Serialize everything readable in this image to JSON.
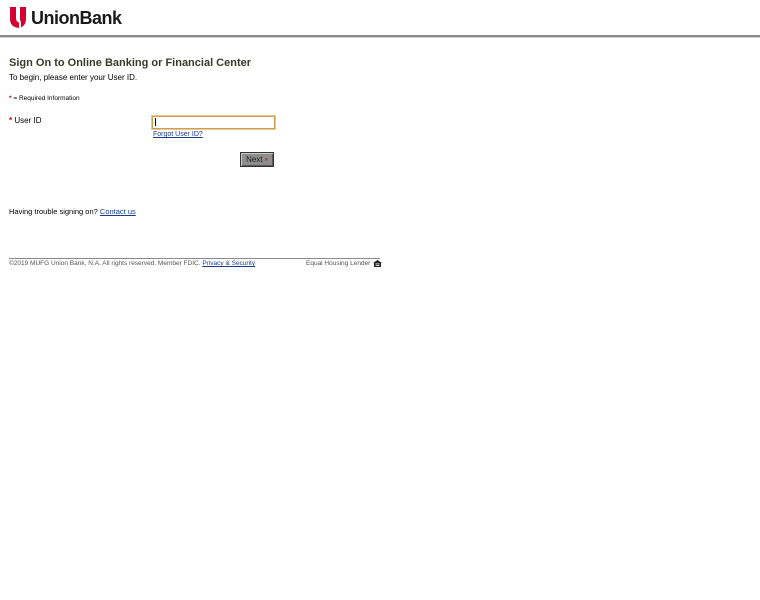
{
  "brand": {
    "name": "UnionBank",
    "logo_color": "#d50032"
  },
  "signon": {
    "title": "Sign On to Online Banking or Financial Center",
    "intro": "To begin, please enter your User ID.",
    "required_star": "*",
    "required_note": "= Required Information",
    "userid_label": "User ID",
    "userid_value": "",
    "forgot_link": "Forgot User ID?",
    "next_label": "Next",
    "next_arrow": "»"
  },
  "help": {
    "text": "Having trouble signing on?",
    "link": "Contact us"
  },
  "footer": {
    "copyright": "©2019 MUFG Union Bank, N.A. All rights reserved. Member FDIC.",
    "privacy_link": "Privacy & Security",
    "ehl": "Equal Housing Lender",
    "ehl_icon": "house-icon"
  }
}
